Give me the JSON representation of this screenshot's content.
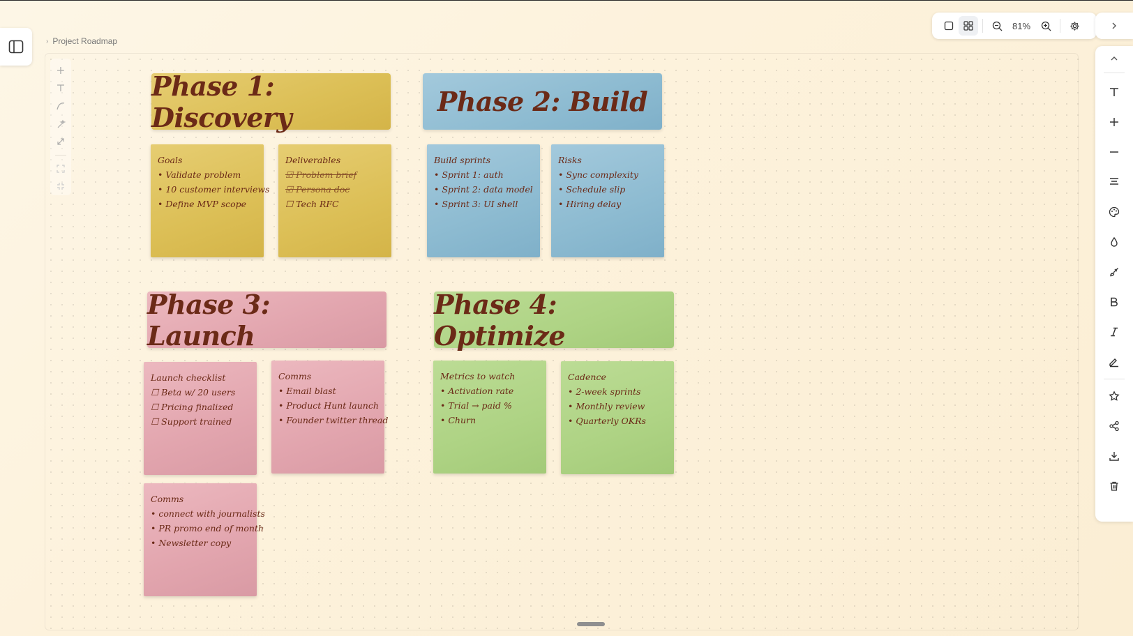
{
  "breadcrumb": {
    "label": "Project Roadmap"
  },
  "toolbar": {
    "zoom": "81%"
  },
  "headers": {
    "phase1": "Phase 1: Discovery",
    "phase2": "Phase 2: Build",
    "phase3": "Phase 3: Launch",
    "phase4": "Phase 4: Optimize"
  },
  "notes": {
    "goals": {
      "title": "Goals",
      "items": [
        "• Validate problem",
        "• 10 customer interviews",
        "• Define MVP scope"
      ]
    },
    "deliverables": {
      "title": "Deliverables",
      "items": [
        "☑ Problem brief",
        "☑ Persona doc",
        "☐ Tech RFC"
      ]
    },
    "build_sprints": {
      "title": "Build sprints",
      "items": [
        "• Sprint 1: auth",
        "• Sprint 2: data model",
        "• Sprint 3: UI shell"
      ]
    },
    "risks": {
      "title": "Risks",
      "items": [
        "• Sync complexity",
        "• Schedule slip",
        "• Hiring delay"
      ]
    },
    "launch_checklist": {
      "title": "Launch checklist",
      "items": [
        "☐ Beta w/ 20 users",
        "☐ Pricing finalized",
        "☐ Support trained"
      ]
    },
    "comms1": {
      "title": "Comms",
      "items": [
        "• Email blast",
        "• Product Hunt launch",
        "• Founder twitter thread"
      ]
    },
    "comms2": {
      "title": "Comms",
      "items": [
        "• connect with journalists",
        "• PR promo end of month",
        "• Newsletter copy"
      ]
    },
    "metrics": {
      "title": "Metrics to watch",
      "items": [
        "• Activation rate",
        "• Trial → paid %",
        "• Churn"
      ]
    },
    "cadence": {
      "title": "Cadence",
      "items": [
        "• 2-week sprints",
        "• Monthly review",
        "• Quarterly OKRs"
      ]
    }
  },
  "colors": {
    "phase1": "#dcbf56",
    "phase2": "#8dbbd1",
    "phase3": "#e2a5ae",
    "phase4": "#aed384",
    "ink": "#6b2a17"
  },
  "icons": {
    "sidebar_toggle": "sidebar-panel-icon",
    "tools": [
      "plus-icon",
      "text-icon",
      "pen-curve-icon",
      "magic-wand-icon",
      "expand-icon"
    ],
    "right_bar": [
      "chevron-up-icon",
      "text-icon",
      "plus-icon",
      "minus-icon",
      "align-icon",
      "palette-icon",
      "drop-icon",
      "brush-icon",
      "bold-icon",
      "italic-icon",
      "signature-icon",
      "star-icon",
      "share-icon",
      "download-icon",
      "trash-icon"
    ]
  }
}
